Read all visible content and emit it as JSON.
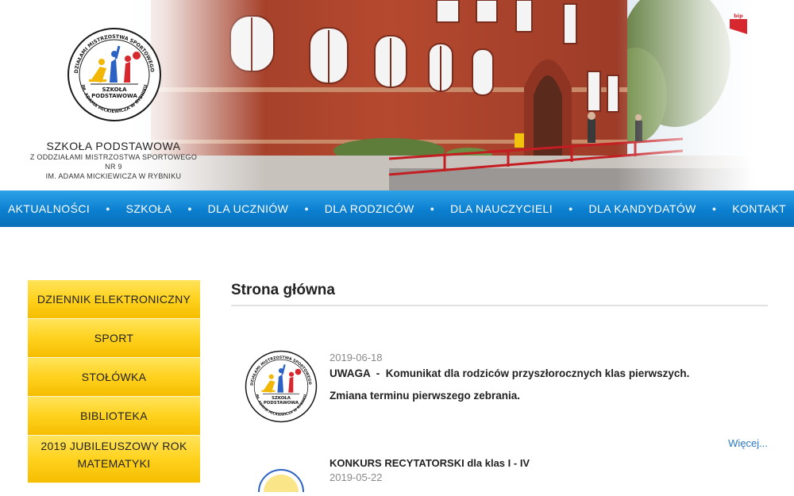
{
  "header": {
    "logo": {
      "ring_text_top": "Z ODDZIAŁAMI MISTRZOSTWA SPORTOWEGO NR 9",
      "ring_text_bottom": "IM. ADAMA MICKIEWICZA W RYBNIKU",
      "center_line1": "SZKOŁA",
      "center_line2": "PODSTAWOWA"
    },
    "school_name_line1": "SZKOŁA PODSTAWOWA",
    "school_name_line2": "Z ODDZIAŁAMI MISTRZOSTWA SPORTOWEGO NR 9",
    "school_name_line3": "IM. ADAMA MICKIEWICZA W RYBNIKU",
    "bip_label": "bip"
  },
  "nav": {
    "items": [
      {
        "label": "AKTUALNOŚCI"
      },
      {
        "label": "SZKOŁA"
      },
      {
        "label": "DLA UCZNIÓW"
      },
      {
        "label": "DLA RODZICÓW"
      },
      {
        "label": "DLA NAUCZYCIELI"
      },
      {
        "label": "DLA KANDYDATÓW"
      },
      {
        "label": "KONTAKT"
      }
    ]
  },
  "sidebar": {
    "items": [
      {
        "label": "DZIENNIK ELEKTRONICZNY"
      },
      {
        "label": "SPORT"
      },
      {
        "label": "STOŁÓWKA"
      },
      {
        "label": "BIBLIOTEKA"
      },
      {
        "label": "2019 JUBILEUSZOWY ROK MATEMATYKI"
      }
    ]
  },
  "main": {
    "page_title": "Strona główna",
    "articles": [
      {
        "date": "2019-06-18",
        "headline": "UWAGA  -  Komunikat dla rodziców przyszłorocznych klas pierwszych.",
        "body": "Zmiana terminu pierwszego zebrania.",
        "more_label": "Więcej..."
      },
      {
        "headline": "KONKURS RECYTATORSKI dla klas I - IV",
        "date": "2019-05-22"
      }
    ]
  },
  "colors": {
    "nav_blue": "#0b7fcf",
    "sidebar_yellow": "#ffd21e",
    "link_blue": "#2a78c0",
    "bip_red": "#d7282f"
  }
}
